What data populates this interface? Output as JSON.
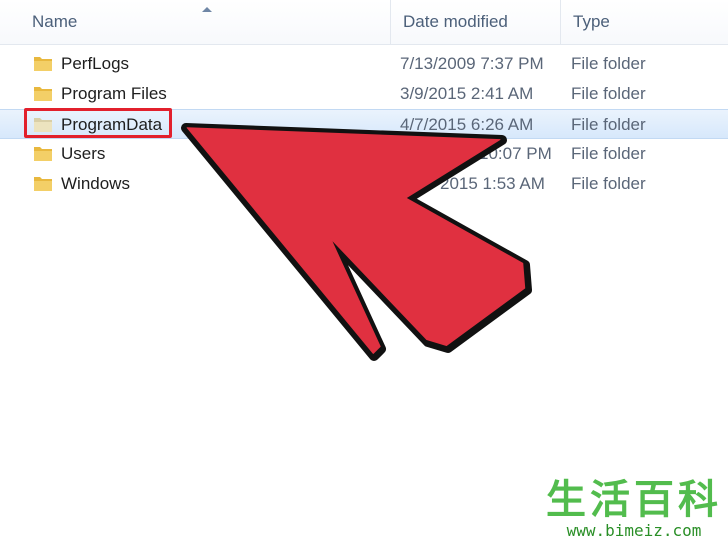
{
  "columns": {
    "name": "Name",
    "date_modified": "Date modified",
    "type": "Type"
  },
  "rows": [
    {
      "name": "PerfLogs",
      "date": "7/13/2009 7:37 PM",
      "type": "File folder",
      "icon": "folder-icon"
    },
    {
      "name": "Program Files",
      "date": "3/9/2015 2:41 AM",
      "type": "File folder",
      "icon": "folder-icon"
    },
    {
      "name": "ProgramData",
      "date": "4/7/2015 6:26 AM",
      "type": "File folder",
      "icon": "folder-icon",
      "selected": true
    },
    {
      "name": "Users",
      "date": "10:07 PM",
      "type": "File folder",
      "icon": "folder-icon"
    },
    {
      "name": "Windows",
      "date": "2015 1:53 AM",
      "type": "File folder",
      "icon": "folder-icon"
    }
  ],
  "colors": {
    "highlight": "#e2202c",
    "arrow_fill": "#e03040",
    "arrow_stroke": "#111111",
    "folder": "#f0c75e",
    "watermark": "#35b12f"
  },
  "watermark": {
    "text": "生活百科",
    "url": "www.bimeiz.com"
  }
}
